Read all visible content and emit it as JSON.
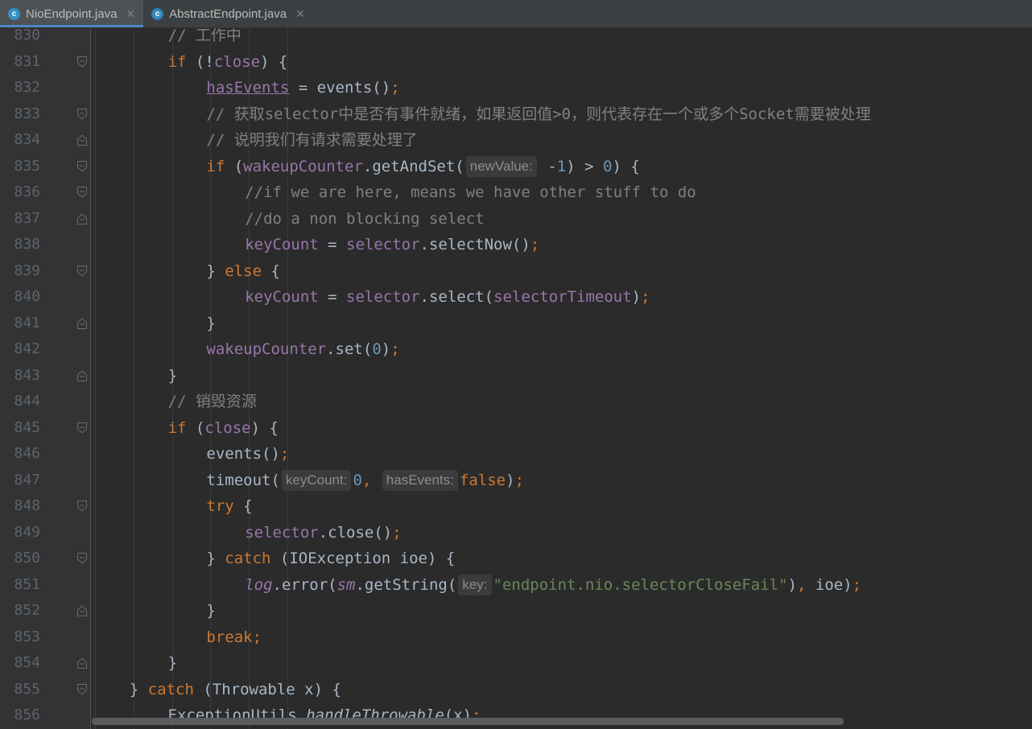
{
  "tabs": [
    {
      "label": "NioEndpoint.java",
      "icon": "c",
      "active": true
    },
    {
      "label": "AbstractEndpoint.java",
      "icon": "c",
      "active": false
    }
  ],
  "lines": [
    {
      "n": "830",
      "indent": 7,
      "fold": "",
      "segs": [
        [
          "cmt",
          "// 工作中"
        ]
      ]
    },
    {
      "n": "831",
      "indent": 7,
      "fold": "open",
      "segs": [
        [
          "kw",
          "if"
        ],
        [
          "p",
          " (!"
        ],
        [
          "fld",
          "close"
        ],
        [
          "p",
          ") {"
        ]
      ]
    },
    {
      "n": "832",
      "indent": 8,
      "fold": "",
      "segs": [
        [
          "fldu",
          "hasEvents"
        ],
        [
          "p",
          " = events()"
        ],
        [
          "kw",
          ";"
        ]
      ]
    },
    {
      "n": "833",
      "indent": 8,
      "fold": "open",
      "segs": [
        [
          "cmt",
          "// 获取selector中是否有事件就绪，如果返回值>0，则代表存在一个或多个Socket需要被处理"
        ]
      ]
    },
    {
      "n": "834",
      "indent": 8,
      "fold": "close",
      "segs": [
        [
          "cmt",
          "// 说明我们有请求需要处理了"
        ]
      ]
    },
    {
      "n": "835",
      "indent": 8,
      "fold": "open",
      "segs": [
        [
          "kw",
          "if"
        ],
        [
          "p",
          " ("
        ],
        [
          "fld",
          "wakeupCounter"
        ],
        [
          "p",
          ".getAndSet("
        ],
        [
          "hint",
          "newValue:"
        ],
        [
          "p",
          " -"
        ],
        [
          "num",
          "1"
        ],
        [
          "p",
          ") > "
        ],
        [
          "num",
          "0"
        ],
        [
          "p",
          ") {"
        ]
      ]
    },
    {
      "n": "836",
      "indent": 9,
      "fold": "open",
      "segs": [
        [
          "cmt",
          "//if we are here, means we have other stuff to do"
        ]
      ]
    },
    {
      "n": "837",
      "indent": 9,
      "fold": "close",
      "segs": [
        [
          "cmt",
          "//do a non blocking select"
        ]
      ]
    },
    {
      "n": "838",
      "indent": 9,
      "fold": "",
      "segs": [
        [
          "fld",
          "keyCount"
        ],
        [
          "p",
          " = "
        ],
        [
          "fld",
          "selector"
        ],
        [
          "p",
          ".selectNow()"
        ],
        [
          "kw",
          ";"
        ]
      ]
    },
    {
      "n": "839",
      "indent": 8,
      "fold": "open",
      "segs": [
        [
          "p",
          "} "
        ],
        [
          "kw",
          "else"
        ],
        [
          "p",
          " {"
        ]
      ]
    },
    {
      "n": "840",
      "indent": 9,
      "fold": "",
      "segs": [
        [
          "fld",
          "keyCount"
        ],
        [
          "p",
          " = "
        ],
        [
          "fld",
          "selector"
        ],
        [
          "p",
          ".select("
        ],
        [
          "fld",
          "selectorTimeout"
        ],
        [
          "p",
          ")"
        ],
        [
          "kw",
          ";"
        ]
      ]
    },
    {
      "n": "841",
      "indent": 8,
      "fold": "close",
      "segs": [
        [
          "p",
          "}"
        ]
      ]
    },
    {
      "n": "842",
      "indent": 8,
      "fold": "",
      "segs": [
        [
          "fld",
          "wakeupCounter"
        ],
        [
          "p",
          ".set("
        ],
        [
          "num",
          "0"
        ],
        [
          "p",
          ")"
        ],
        [
          "kw",
          ";"
        ]
      ]
    },
    {
      "n": "843",
      "indent": 7,
      "fold": "close",
      "segs": [
        [
          "p",
          "}"
        ]
      ]
    },
    {
      "n": "844",
      "indent": 7,
      "fold": "",
      "segs": [
        [
          "cmt",
          "// 销毁资源"
        ]
      ]
    },
    {
      "n": "845",
      "indent": 7,
      "fold": "open",
      "segs": [
        [
          "kw",
          "if"
        ],
        [
          "p",
          " ("
        ],
        [
          "fld",
          "close"
        ],
        [
          "p",
          ") {"
        ]
      ]
    },
    {
      "n": "846",
      "indent": 8,
      "fold": "",
      "segs": [
        [
          "p",
          "events()"
        ],
        [
          "kw",
          ";"
        ]
      ]
    },
    {
      "n": "847",
      "indent": 8,
      "fold": "",
      "segs": [
        [
          "p",
          "timeout("
        ],
        [
          "hint",
          "keyCount:"
        ],
        [
          "num",
          "0"
        ],
        [
          "kw",
          ", "
        ],
        [
          "hint",
          "hasEvents:"
        ],
        [
          "kw",
          "false"
        ],
        [
          "p",
          ")"
        ],
        [
          "kw",
          ";"
        ]
      ]
    },
    {
      "n": "848",
      "indent": 8,
      "fold": "open",
      "segs": [
        [
          "kw",
          "try"
        ],
        [
          "p",
          " {"
        ]
      ]
    },
    {
      "n": "849",
      "indent": 9,
      "fold": "",
      "segs": [
        [
          "fld",
          "selector"
        ],
        [
          "p",
          ".close()"
        ],
        [
          "kw",
          ";"
        ]
      ]
    },
    {
      "n": "850",
      "indent": 8,
      "fold": "open",
      "segs": [
        [
          "p",
          "} "
        ],
        [
          "kw",
          "catch"
        ],
        [
          "p",
          " (IOException ioe) {"
        ]
      ]
    },
    {
      "n": "851",
      "indent": 9,
      "fold": "",
      "segs": [
        [
          "fldi",
          "log"
        ],
        [
          "p",
          ".error("
        ],
        [
          "fldi",
          "sm"
        ],
        [
          "p",
          ".getString("
        ],
        [
          "hint",
          "key:"
        ],
        [
          "str",
          "\"endpoint.nio.selectorCloseFail\""
        ],
        [
          "p",
          ")"
        ],
        [
          "kw",
          ", "
        ],
        [
          "p",
          "ioe)"
        ],
        [
          "kw",
          ";"
        ]
      ]
    },
    {
      "n": "852",
      "indent": 8,
      "fold": "close",
      "segs": [
        [
          "p",
          "}"
        ]
      ]
    },
    {
      "n": "853",
      "indent": 8,
      "fold": "",
      "segs": [
        [
          "kw",
          "break;"
        ]
      ]
    },
    {
      "n": "854",
      "indent": 7,
      "fold": "close",
      "segs": [
        [
          "p",
          "}"
        ]
      ]
    },
    {
      "n": "855",
      "indent": 6,
      "fold": "open",
      "segs": [
        [
          "p",
          "} "
        ],
        [
          "kw",
          "catch"
        ],
        [
          "p",
          " (Throwable x) {"
        ]
      ]
    },
    {
      "n": "856",
      "indent": 7,
      "fold": "",
      "segs": [
        [
          "p",
          "ExceptionUtils."
        ],
        [
          "ital",
          "handleThrowable"
        ],
        [
          "p",
          "(x)"
        ],
        [
          "kw",
          ";"
        ]
      ]
    }
  ],
  "colors": {
    "background": "#2b2b2b",
    "gutter": "#313335",
    "keyword": "#cc7832",
    "field": "#9876aa",
    "number": "#6897bb",
    "comment": "#808080",
    "string": "#6a8759",
    "text": "#a9b7c6",
    "accent": "#4a88c7"
  },
  "icons": {
    "tab_file": "java-class-icon",
    "tab_close": "close-icon",
    "fold_open": "fold-open-icon",
    "fold_close": "fold-close-icon"
  }
}
